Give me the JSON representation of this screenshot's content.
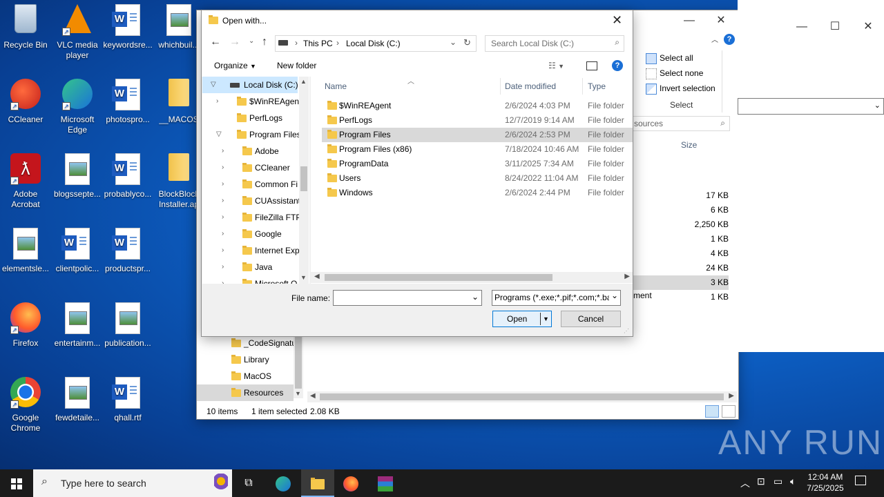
{
  "desktop_icons": [
    {
      "label": "Recycle Bin",
      "icon": "recycle-bin-icon"
    },
    {
      "label": "VLC media player",
      "icon": "vlc-icon"
    },
    {
      "label": "keywordsre...",
      "icon": "word-doc-icon"
    },
    {
      "label": "whichbuil...",
      "icon": "image-file-icon"
    },
    {
      "label": "CCleaner",
      "icon": "ccleaner-icon"
    },
    {
      "label": "Microsoft Edge",
      "icon": "edge-icon"
    },
    {
      "label": "photospro...",
      "icon": "word-doc-icon"
    },
    {
      "label": "__MACOS",
      "icon": "folder-icon"
    },
    {
      "label": "Adobe Acrobat",
      "icon": "acrobat-icon"
    },
    {
      "label": "blogssepte...",
      "icon": "image-file-icon"
    },
    {
      "label": "probablyco...",
      "icon": "word-doc-icon"
    },
    {
      "label": "BlockBlock Installer.ap",
      "icon": "folder-icon"
    },
    {
      "label": "elementsle...",
      "icon": "image-file-icon"
    },
    {
      "label": "clientpolic...",
      "icon": "word-doc-icon"
    },
    {
      "label": "productspr...",
      "icon": "word-doc-icon"
    },
    {
      "label": "Firefox",
      "icon": "firefox-icon"
    },
    {
      "label": "entertainm...",
      "icon": "image-file-icon"
    },
    {
      "label": "publication...",
      "icon": "image-file-icon"
    },
    {
      "label": "Google Chrome",
      "icon": "chrome-icon"
    },
    {
      "label": "fewdetaile...",
      "icon": "image-file-icon"
    },
    {
      "label": "qhall.rtf",
      "icon": "word-doc-icon"
    }
  ],
  "explorer": {
    "ribbon": {
      "select_all": "Select all",
      "select_none": "Select none",
      "invert_selection": "Invert selection",
      "group": "Select"
    },
    "search_placeholder": "sources",
    "size_header": "Size",
    "sizes": [
      "17 KB",
      "6 KB",
      "2,250 KB",
      "1 KB",
      "4 KB",
      "24 KB",
      "3 KB",
      "1 KB"
    ],
    "type_fragment": "ment",
    "tree": [
      "_CodeSignatu",
      "Library",
      "MacOS",
      "Resources"
    ],
    "status": {
      "count": "10 items",
      "selected": "1 item selected",
      "size": "2.08 KB"
    }
  },
  "dialog": {
    "title": "Open with...",
    "breadcrumb": [
      "This PC",
      "Local Disk (C:)"
    ],
    "search_placeholder": "Search Local Disk (C:)",
    "toolbar": {
      "organize": "Organize",
      "new_folder": "New folder"
    },
    "columns": {
      "name": "Name",
      "date": "Date modified",
      "type": "Type"
    },
    "tree": [
      {
        "label": "Local Disk (C:)",
        "level": 0,
        "expanded": true,
        "selected": true
      },
      {
        "label": "$WinREAgent",
        "level": 1,
        "expander": true
      },
      {
        "label": "PerfLogs",
        "level": 1
      },
      {
        "label": "Program Files",
        "level": 1,
        "expanded": true
      },
      {
        "label": "Adobe",
        "level": 2,
        "expander": true
      },
      {
        "label": "CCleaner",
        "level": 2,
        "expander": true
      },
      {
        "label": "Common Fi",
        "level": 2,
        "expander": true
      },
      {
        "label": "CUAssistant",
        "level": 2,
        "expander": true
      },
      {
        "label": "FileZilla FTP",
        "level": 2,
        "expander": true
      },
      {
        "label": "Google",
        "level": 2,
        "expander": true
      },
      {
        "label": "Internet Exp",
        "level": 2,
        "expander": true
      },
      {
        "label": "Java",
        "level": 2,
        "expander": true
      },
      {
        "label": "Microsoft O",
        "level": 2,
        "expander": true
      }
    ],
    "files": [
      {
        "name": "$WinREAgent",
        "date": "2/6/2024 4:03 PM",
        "type": "File folder"
      },
      {
        "name": "PerfLogs",
        "date": "12/7/2019 9:14 AM",
        "type": "File folder"
      },
      {
        "name": "Program Files",
        "date": "2/6/2024 2:53 PM",
        "type": "File folder",
        "selected": true
      },
      {
        "name": "Program Files (x86)",
        "date": "7/18/2024 10:46 AM",
        "type": "File folder"
      },
      {
        "name": "ProgramData",
        "date": "3/11/2025 7:34 AM",
        "type": "File folder"
      },
      {
        "name": "Users",
        "date": "8/24/2022 11:04 AM",
        "type": "File folder"
      },
      {
        "name": "Windows",
        "date": "2/6/2024 2:44 PM",
        "type": "File folder"
      }
    ],
    "file_name_label": "File name:",
    "file_name_value": "",
    "file_type": "Programs (*.exe;*.pif;*.com;*.ba",
    "open_button": "Open",
    "cancel_button": "Cancel"
  },
  "taskbar": {
    "search_placeholder": "Type here to search",
    "time": "12:04 AM",
    "date": "7/25/2025"
  },
  "watermark": "ANY RUN"
}
